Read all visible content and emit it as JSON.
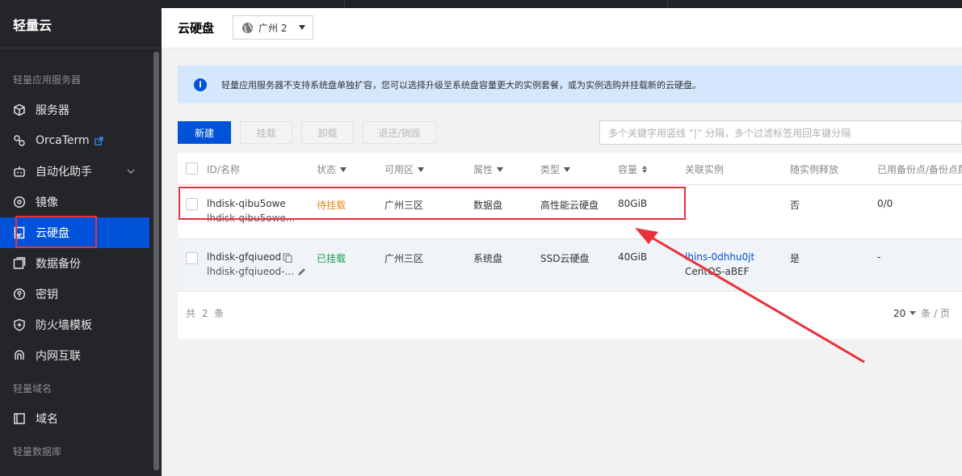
{
  "sidebar": {
    "brand": "轻量云",
    "sections": [
      "轻量应用服务器",
      "轻量域名",
      "轻量数据库"
    ],
    "items": [
      {
        "label": "服务器",
        "icon": "cube-icon"
      },
      {
        "label": "OrcaTerm",
        "icon": "terminal-icon"
      },
      {
        "label": "自动化助手",
        "icon": "robot-icon"
      },
      {
        "label": "镜像",
        "icon": "disc-icon"
      },
      {
        "label": "云硬盘",
        "icon": "disk-icon"
      },
      {
        "label": "数据备份",
        "icon": "backup-icon"
      },
      {
        "label": "密钥",
        "icon": "key-icon"
      },
      {
        "label": "防火墙模板",
        "icon": "shield-icon"
      },
      {
        "label": "内网互联",
        "icon": "network-icon"
      },
      {
        "label": "域名",
        "icon": "domain-icon"
      }
    ],
    "active_item": "云硬盘"
  },
  "header": {
    "title": "云硬盘",
    "region": "广州 2"
  },
  "banner": {
    "text": "轻量应用服务器不支持系统盘单独扩容，您可以选择升级至系统盘容量更大的实例套餐，或为实例选购并挂载新的云硬盘。"
  },
  "toolbar": {
    "new_label": "新建",
    "mount_label": "挂载",
    "unmount_label": "卸载",
    "return_label": "退还/销毁",
    "search_placeholder": "多个关键字用竖线 “|” 分隔，多个过滤标签用回车键分隔"
  },
  "table": {
    "headers": [
      "ID/名称",
      "状态",
      "可用区",
      "属性",
      "类型",
      "容量",
      "关联实例",
      "随实例释放",
      "已用备份点/备份点配"
    ],
    "rows": [
      {
        "id": "lhdisk-qibu5owe",
        "name": "lhdisk-qibu5owe...",
        "status": "待挂载",
        "zone": "广州三区",
        "attr": "数据盘",
        "type": "高性能云硬盘",
        "size": "80GiB",
        "instance_id": "",
        "instance_name": "",
        "release": "否",
        "backup": "0/0"
      },
      {
        "id": "lhdisk-gfqiueod",
        "name": "lhdisk-gfqiueod-...",
        "status": "已挂载",
        "zone": "广州三区",
        "attr": "系统盘",
        "type": "SSD云硬盘",
        "size": "40GiB",
        "instance_id": "lhins-0dhhu0jt",
        "instance_name": "CentOS-aBEF",
        "release": "是",
        "backup": "-"
      }
    ],
    "total": "共 2 条",
    "page_size": "20",
    "page_unit": "条 / 页"
  },
  "colors": {
    "accent": "#0052d9",
    "annotation": "#e8313a",
    "status_wait": "#e38a1d",
    "status_ok": "#16a34a"
  }
}
